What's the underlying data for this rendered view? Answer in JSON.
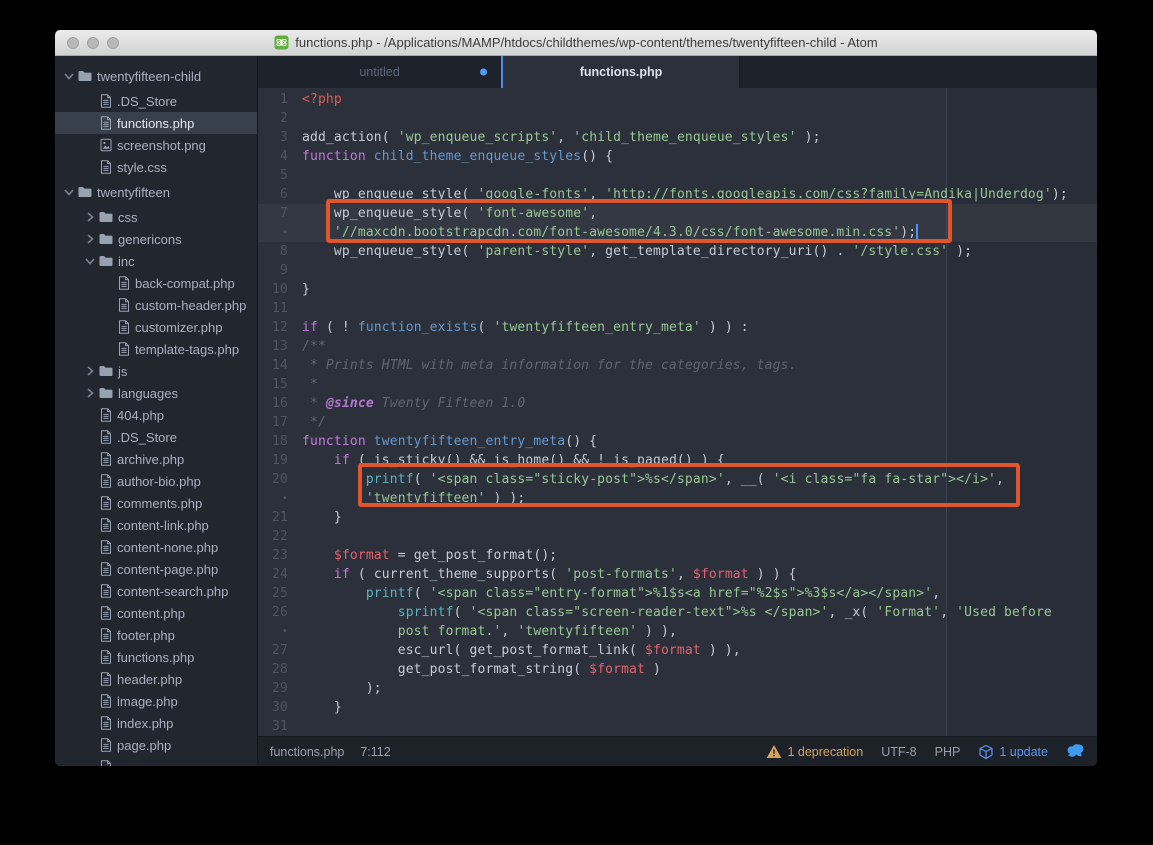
{
  "window": {
    "title": "functions.php - /Applications/MAMP/htdocs/childthemes/wp-content/themes/twentyfifteen-child - Atom"
  },
  "tabs": [
    {
      "label": "untitled",
      "modified": true,
      "active": false
    },
    {
      "label": "functions.php",
      "modified": false,
      "active": true
    }
  ],
  "sidebar": {
    "items": [
      {
        "kind": "folder",
        "depth": 0,
        "expanded": true,
        "label": "twentyfifteen-child"
      },
      {
        "kind": "file",
        "depth": 1,
        "label": ".DS_Store"
      },
      {
        "kind": "file",
        "depth": 1,
        "label": "functions.php",
        "selected": true
      },
      {
        "kind": "image",
        "depth": 1,
        "label": "screenshot.png"
      },
      {
        "kind": "file",
        "depth": 1,
        "label": "style.css"
      },
      {
        "kind": "folder",
        "depth": 0,
        "expanded": true,
        "label": "twentyfifteen"
      },
      {
        "kind": "folder",
        "depth": 1,
        "expanded": false,
        "label": "css"
      },
      {
        "kind": "folder",
        "depth": 1,
        "expanded": false,
        "label": "genericons"
      },
      {
        "kind": "folder",
        "depth": 1,
        "expanded": true,
        "label": "inc"
      },
      {
        "kind": "file",
        "depth": 2,
        "label": "back-compat.php"
      },
      {
        "kind": "file",
        "depth": 2,
        "label": "custom-header.php"
      },
      {
        "kind": "file",
        "depth": 2,
        "label": "customizer.php"
      },
      {
        "kind": "file",
        "depth": 2,
        "label": "template-tags.php"
      },
      {
        "kind": "folder",
        "depth": 1,
        "expanded": false,
        "label": "js"
      },
      {
        "kind": "folder",
        "depth": 1,
        "expanded": false,
        "label": "languages"
      },
      {
        "kind": "file",
        "depth": 1,
        "label": "404.php"
      },
      {
        "kind": "file",
        "depth": 1,
        "label": ".DS_Store"
      },
      {
        "kind": "file",
        "depth": 1,
        "label": "archive.php"
      },
      {
        "kind": "file",
        "depth": 1,
        "label": "author-bio.php"
      },
      {
        "kind": "file",
        "depth": 1,
        "label": "comments.php"
      },
      {
        "kind": "file",
        "depth": 1,
        "label": "content-link.php"
      },
      {
        "kind": "file",
        "depth": 1,
        "label": "content-none.php"
      },
      {
        "kind": "file",
        "depth": 1,
        "label": "content-page.php"
      },
      {
        "kind": "file",
        "depth": 1,
        "label": "content-search.php"
      },
      {
        "kind": "file",
        "depth": 1,
        "label": "content.php"
      },
      {
        "kind": "file",
        "depth": 1,
        "label": "footer.php"
      },
      {
        "kind": "file",
        "depth": 1,
        "label": "functions.php"
      },
      {
        "kind": "file",
        "depth": 1,
        "label": "header.php"
      },
      {
        "kind": "file",
        "depth": 1,
        "label": "image.php"
      },
      {
        "kind": "file",
        "depth": 1,
        "label": "index.php"
      },
      {
        "kind": "file",
        "depth": 1,
        "label": "page.php"
      },
      {
        "kind": "file",
        "depth": 1,
        "label": ""
      }
    ]
  },
  "editor": {
    "lines": [
      {
        "n": "1",
        "t": [
          [
            "php",
            "<?php"
          ]
        ]
      },
      {
        "n": "2",
        "t": []
      },
      {
        "n": "3",
        "t": [
          [
            "pl",
            "add_action( "
          ],
          [
            "str",
            "'wp_enqueue_scripts'"
          ],
          [
            "pl",
            ", "
          ],
          [
            "str",
            "'child_theme_enqueue_styles'"
          ],
          [
            "pl",
            " );"
          ]
        ]
      },
      {
        "n": "4",
        "t": [
          [
            "kw",
            "function "
          ],
          [
            "fn",
            "child_theme_enqueue_styles"
          ],
          [
            "pl",
            "() {"
          ]
        ]
      },
      {
        "n": "5",
        "t": []
      },
      {
        "n": "6",
        "t": [
          [
            "pl",
            "    wp_enqueue_style( "
          ],
          [
            "str",
            "'google-fonts'"
          ],
          [
            "pl",
            ", "
          ],
          [
            "str",
            "'http://fonts.googleapis.com/css?family=Andika|Underdog'"
          ],
          [
            "pl",
            ");"
          ]
        ]
      },
      {
        "n": "7",
        "hl": true,
        "t": [
          [
            "pl",
            "    wp_enqueue_style( "
          ],
          [
            "str",
            "'font-awesome'"
          ],
          [
            "pl",
            ","
          ]
        ]
      },
      {
        "n": "•",
        "wrap": true,
        "hl": true,
        "cursor": true,
        "t": [
          [
            "str",
            "    '//maxcdn.bootstrapcdn.com/font-awesome/4.3.0/css/font-awesome.min.css'"
          ],
          [
            "pl",
            ");"
          ]
        ]
      },
      {
        "n": "8",
        "t": [
          [
            "pl",
            "    wp_enqueue_style( "
          ],
          [
            "str",
            "'parent-style'"
          ],
          [
            "pl",
            ", get_template_directory_uri() . "
          ],
          [
            "str",
            "'/style.css'"
          ],
          [
            "pl",
            " );"
          ]
        ]
      },
      {
        "n": "9",
        "t": []
      },
      {
        "n": "10",
        "t": [
          [
            "pl",
            "}"
          ]
        ]
      },
      {
        "n": "11",
        "t": []
      },
      {
        "n": "12",
        "t": [
          [
            "kw",
            "if"
          ],
          [
            "pl",
            " ( ! "
          ],
          [
            "fn",
            "function_exists"
          ],
          [
            "pl",
            "( "
          ],
          [
            "str",
            "'twentyfifteen_entry_meta'"
          ],
          [
            "pl",
            " ) ) :"
          ]
        ]
      },
      {
        "n": "13",
        "t": [
          [
            "cmt",
            "/**"
          ]
        ]
      },
      {
        "n": "14",
        "t": [
          [
            "cmt",
            " * Prints HTML with meta information for the categories, tags."
          ]
        ]
      },
      {
        "n": "15",
        "t": [
          [
            "cmt",
            " *"
          ]
        ]
      },
      {
        "n": "16",
        "t": [
          [
            "cmt",
            " * "
          ],
          [
            "doc",
            "@since"
          ],
          [
            "cmt",
            " Twenty Fifteen 1.0"
          ]
        ]
      },
      {
        "n": "17",
        "t": [
          [
            "cmt",
            " */"
          ]
        ]
      },
      {
        "n": "18",
        "t": [
          [
            "kw",
            "function "
          ],
          [
            "fn",
            "twentyfifteen_entry_meta"
          ],
          [
            "pl",
            "() {"
          ]
        ]
      },
      {
        "n": "19",
        "t": [
          [
            "pl",
            "    "
          ],
          [
            "kw",
            "if"
          ],
          [
            "pl",
            " ( is_sticky() && is_home() && ! is_paged() ) {"
          ]
        ]
      },
      {
        "n": "20",
        "t": [
          [
            "pl",
            "        "
          ],
          [
            "bi",
            "printf"
          ],
          [
            "pl",
            "( "
          ],
          [
            "str",
            "'<span class=\"sticky-post\">%s</span>'"
          ],
          [
            "pl",
            ", __( "
          ],
          [
            "str",
            "'<i class=\"fa fa-star\"></i>'"
          ],
          [
            "pl",
            ","
          ]
        ]
      },
      {
        "n": "•",
        "wrap": true,
        "t": [
          [
            "str",
            "        'twentyfifteen'"
          ],
          [
            "pl",
            " ) );"
          ]
        ]
      },
      {
        "n": "21",
        "t": [
          [
            "pl",
            "    }"
          ]
        ]
      },
      {
        "n": "22",
        "t": []
      },
      {
        "n": "23",
        "t": [
          [
            "pl",
            "    "
          ],
          [
            "var",
            "$format"
          ],
          [
            "pl",
            " = get_post_format();"
          ]
        ]
      },
      {
        "n": "24",
        "t": [
          [
            "pl",
            "    "
          ],
          [
            "kw",
            "if"
          ],
          [
            "pl",
            " ( current_theme_supports( "
          ],
          [
            "str",
            "'post-formats'"
          ],
          [
            "pl",
            ", "
          ],
          [
            "var",
            "$format"
          ],
          [
            "pl",
            " ) ) {"
          ]
        ]
      },
      {
        "n": "25",
        "t": [
          [
            "pl",
            "        "
          ],
          [
            "bi",
            "printf"
          ],
          [
            "pl",
            "( "
          ],
          [
            "str",
            "'<span class=\"entry-format\">%1$s<a href=\"%2$s\">%3$s</a></span>'"
          ],
          [
            "pl",
            ","
          ]
        ]
      },
      {
        "n": "26",
        "t": [
          [
            "pl",
            "            "
          ],
          [
            "bi",
            "sprintf"
          ],
          [
            "pl",
            "( "
          ],
          [
            "str",
            "'<span class=\"screen-reader-text\">%s </span>'"
          ],
          [
            "pl",
            ", _x( "
          ],
          [
            "str",
            "'Format'"
          ],
          [
            "pl",
            ", "
          ],
          [
            "str",
            "'Used before"
          ]
        ]
      },
      {
        "n": "•",
        "wrap": true,
        "t": [
          [
            "str",
            "            post format.'"
          ],
          [
            "pl",
            ", "
          ],
          [
            "str",
            "'twentyfifteen'"
          ],
          [
            "pl",
            " ) ),"
          ]
        ]
      },
      {
        "n": "27",
        "t": [
          [
            "pl",
            "            esc_url( get_post_format_link( "
          ],
          [
            "var",
            "$format"
          ],
          [
            "pl",
            " ) ),"
          ]
        ]
      },
      {
        "n": "28",
        "t": [
          [
            "pl",
            "            get_post_format_string( "
          ],
          [
            "var",
            "$format"
          ],
          [
            "pl",
            " )"
          ]
        ]
      },
      {
        "n": "29",
        "t": [
          [
            "pl",
            "        );"
          ]
        ]
      },
      {
        "n": "30",
        "t": [
          [
            "pl",
            "    }"
          ]
        ]
      },
      {
        "n": "31",
        "t": []
      }
    ]
  },
  "statusbar": {
    "file": "functions.php",
    "position": "7:112",
    "deprecation": "1 deprecation",
    "encoding": "UTF-8",
    "language": "PHP",
    "update": "1 update"
  },
  "colors": {
    "editor_bg": "#2B303B",
    "sidebar_bg": "#22262F",
    "tabbar_bg": "#1D2129",
    "statusbar_bg": "#1D2128",
    "annotation_orange": "#E0552B",
    "accent_blue": "#4E8CF0",
    "string_green": "#99C794",
    "keyword_magenta": "#C678DD",
    "function_blue": "#6699CC",
    "builtin_cyan": "#56B6C2",
    "variable_red": "#E5616E",
    "comment_gray": "#5F6672",
    "warning_amber": "#D7A15F",
    "file_icon_green": "#5FAE3F"
  }
}
